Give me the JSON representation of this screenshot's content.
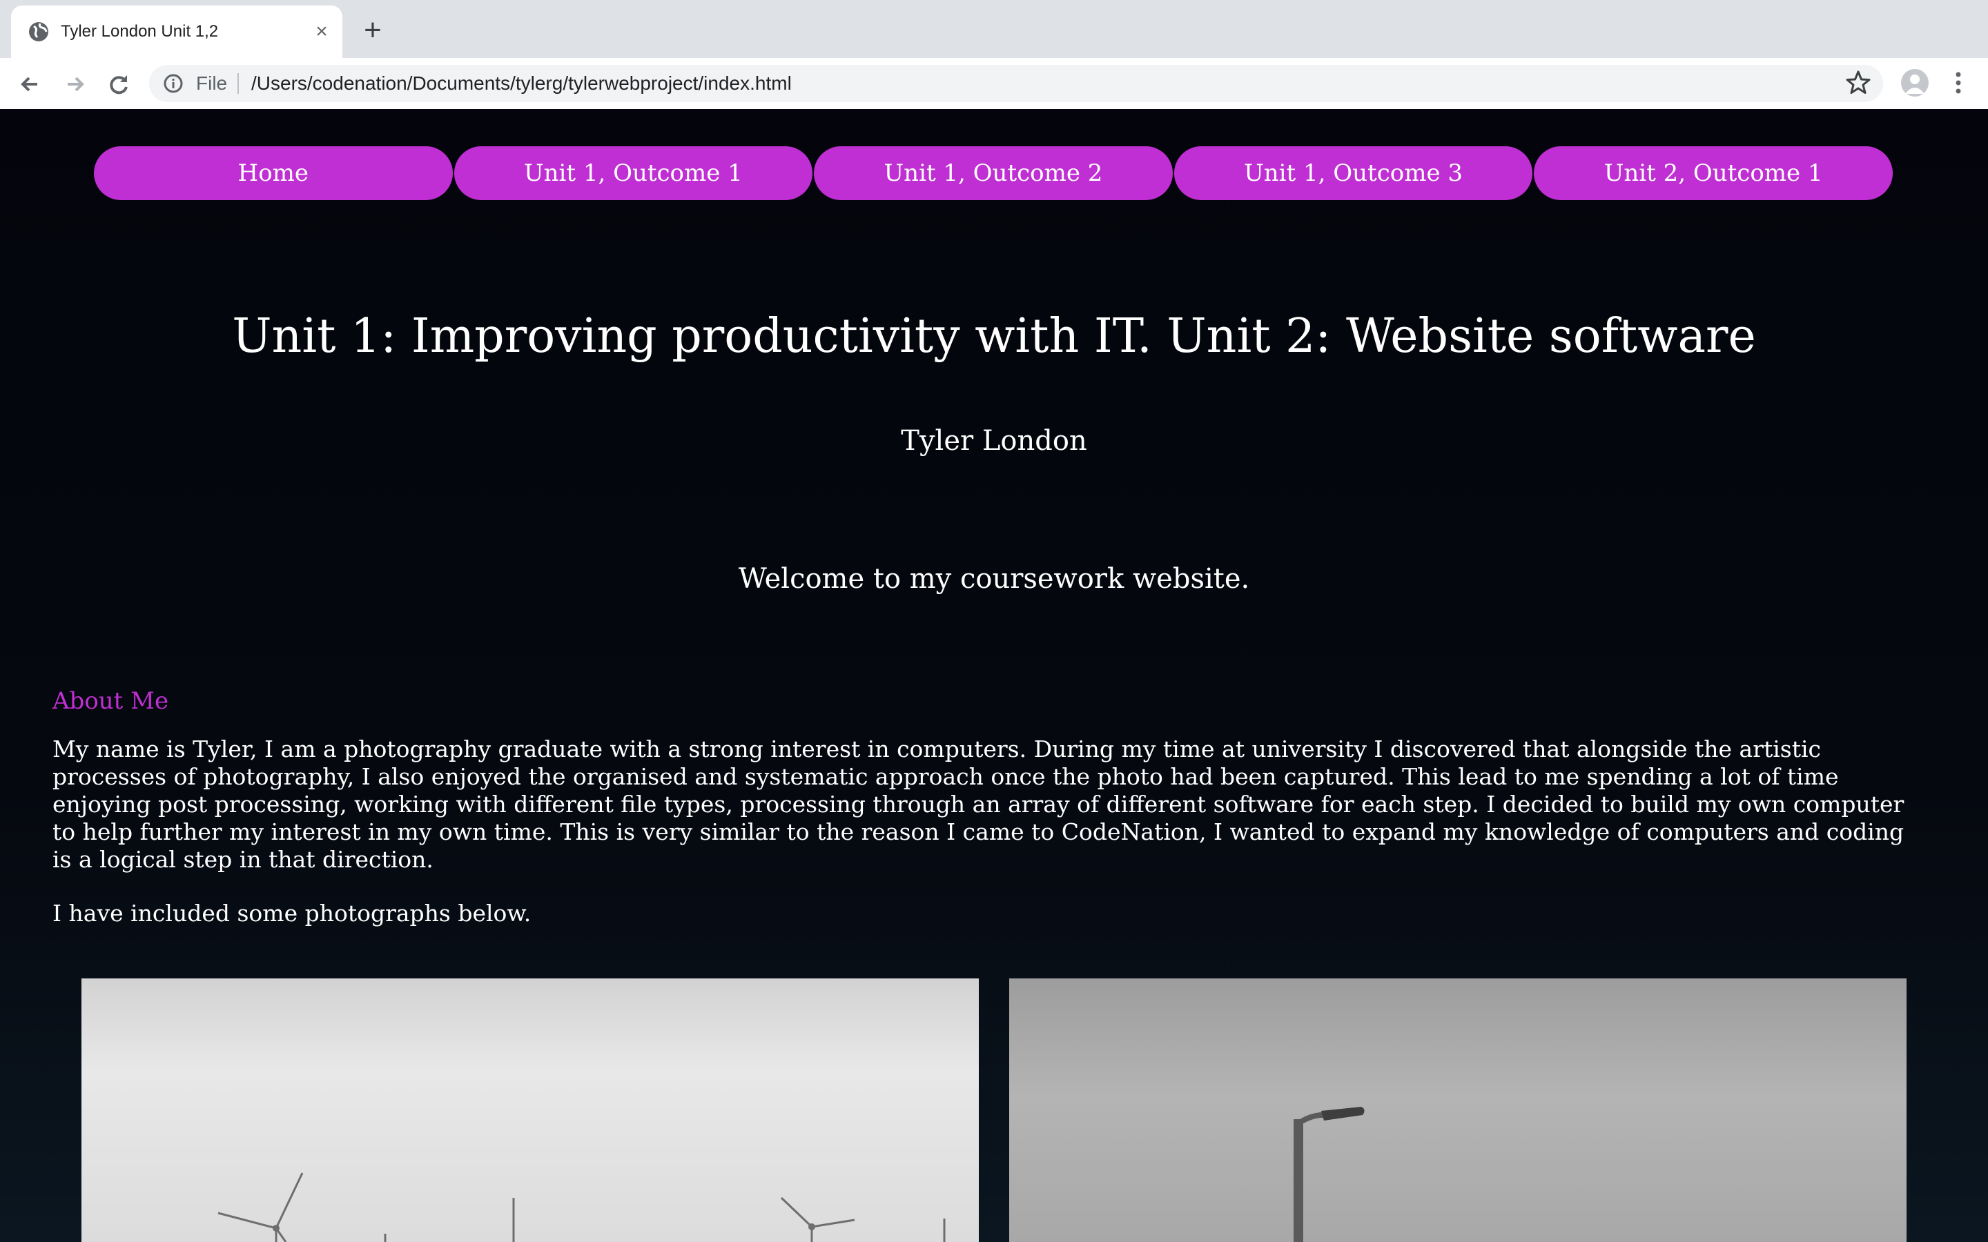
{
  "browser": {
    "tab": {
      "title": "Tyler London Unit 1,2",
      "favicon": "globe-icon",
      "close": "×"
    },
    "new_tab": "+",
    "address": {
      "scheme_label": "File",
      "url": "/Users/codenation/Documents/tylerg/tylerwebproject/index.html"
    }
  },
  "nav": {
    "items": [
      {
        "label": "Home"
      },
      {
        "label": "Unit 1, Outcome 1"
      },
      {
        "label": "Unit 1, Outcome 2"
      },
      {
        "label": "Unit 1, Outcome 3"
      },
      {
        "label": "Unit 2, Outcome 1"
      }
    ],
    "pill_color": "#c02fd3"
  },
  "header": {
    "title": "Unit 1: Improving productivity with IT. Unit 2: Website software",
    "author": "Tyler London",
    "welcome": "Welcome to my coursework website."
  },
  "about": {
    "heading": "About Me",
    "body": "My name is Tyler, I am a photography graduate with a strong interest in computers. During my time at university I discovered that alongside the artistic processes of photography, I also enjoyed the organised and systematic approach once the photo had been captured. This lead to me spending a lot of time enjoying post processing, working with different file types, processing through an array of different software for each step. I decided to build my own computer to help further my interest in my own time. This is very similar to the reason I came to CodeNation, I wanted to expand my knowledge of computers and coding is a logical step in that direction.",
    "photos_intro": "I have included some photographs below.",
    "accent_color": "#c02fd3"
  },
  "photos": [
    {
      "subject": "wind-turbines"
    },
    {
      "subject": "street-lamp"
    }
  ]
}
